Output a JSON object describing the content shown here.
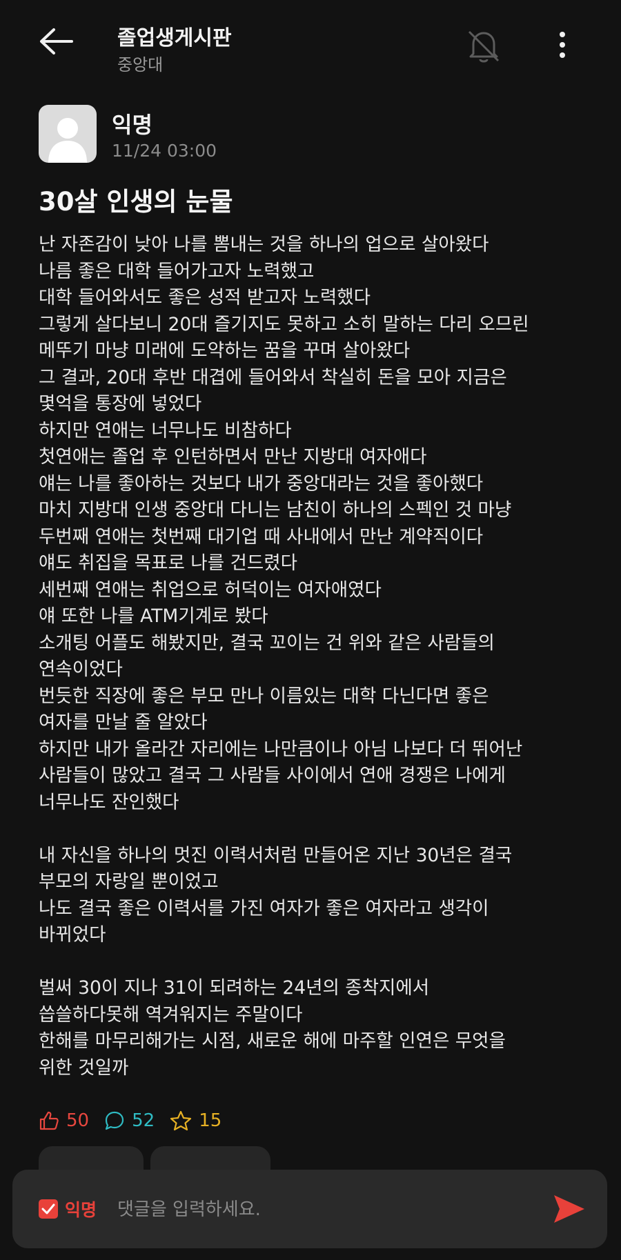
{
  "header": {
    "title": "졸업생게시판",
    "subtitle": "중앙대",
    "icons": {
      "back": "arrow-left-icon",
      "notification": "bell-off-icon",
      "more": "more-vertical-icon"
    }
  },
  "post": {
    "author": "익명",
    "time": "11/24 03:00",
    "title": "30살 인생의 눈물",
    "lines": [
      "난 자존감이 낮아 나를 뽐내는 것을 하나의 업으로 살아왔다",
      "나름 좋은 대학 들어가고자 노력했고",
      "대학 들어와서도 좋은 성적 받고자 노력했다",
      "그렇게 살다보니 20대 즐기지도 못하고 소히 말하는 다리 오므린",
      "메뚜기 마냥 미래에 도약하는 꿈을 꾸며 살아왔다",
      "그 결과, 20대 후반 대겹에 들어와서 착실히 돈을 모아 지금은",
      "몇억을 통장에 넣었다",
      "하지만 연애는 너무나도 비참하다",
      "첫연애는 졸업 후 인턴하면서 만난 지방대 여자애다",
      "얘는 나를 좋아하는 것보다 내가 중앙대라는 것을 좋아했다",
      "마치 지방대 인생 중앙대 다니는 남친이 하나의 스펙인 것 마냥",
      "두번째 연애는 첫번째 대기업 때 사내에서 만난 계약직이다",
      "얘도 취집을 목표로 나를 건드렸다",
      "세번째 연애는 취업으로 허덕이는 여자애였다",
      "얘 또한 나를 ATM기계로 봤다",
      "소개팅 어플도 해봤지만, 결국 꼬이는 건 위와 같은 사람들의",
      "연속이었다",
      "번듯한 직장에 좋은 부모 만나 이름있는 대학 다닌다면 좋은",
      "여자를 만날 줄 알았다",
      "하지만 내가 올라간 자리에는 나만큼이나 아님 나보다 더 뛰어난",
      "사람들이 많았고 결국 그 사람들 사이에서 연애 경쟁은 나에게",
      "너무나도 잔인했다",
      "",
      "내 자신을 하나의 멋진 이력서처럼 만들어온 지난 30년은 결국",
      "부모의 자랑일 뿐이었고",
      "나도 결국 좋은 이력서를 가진 여자가 좋은 여자라고 생각이",
      "바뀌었다",
      "",
      "벌써 30이 지나 31이 되려하는 24년의 종착지에서",
      "씁쓸하다못해 역겨워지는 주말이다",
      "한해를 마무리해가는 시점, 새로운 해에 마주할 인연은 무엇을",
      "위한 것일까"
    ]
  },
  "stats": {
    "likes": "50",
    "comments": "52",
    "scraps": "15",
    "colors": {
      "like": "#e8473f",
      "comment": "#2fbcc4",
      "scrap": "#e7b124"
    }
  },
  "comment_bar": {
    "anonymous_label": "익명",
    "anonymous_checked": true,
    "placeholder": "댓글을 입력하세요.",
    "accent": "#e8413a"
  }
}
